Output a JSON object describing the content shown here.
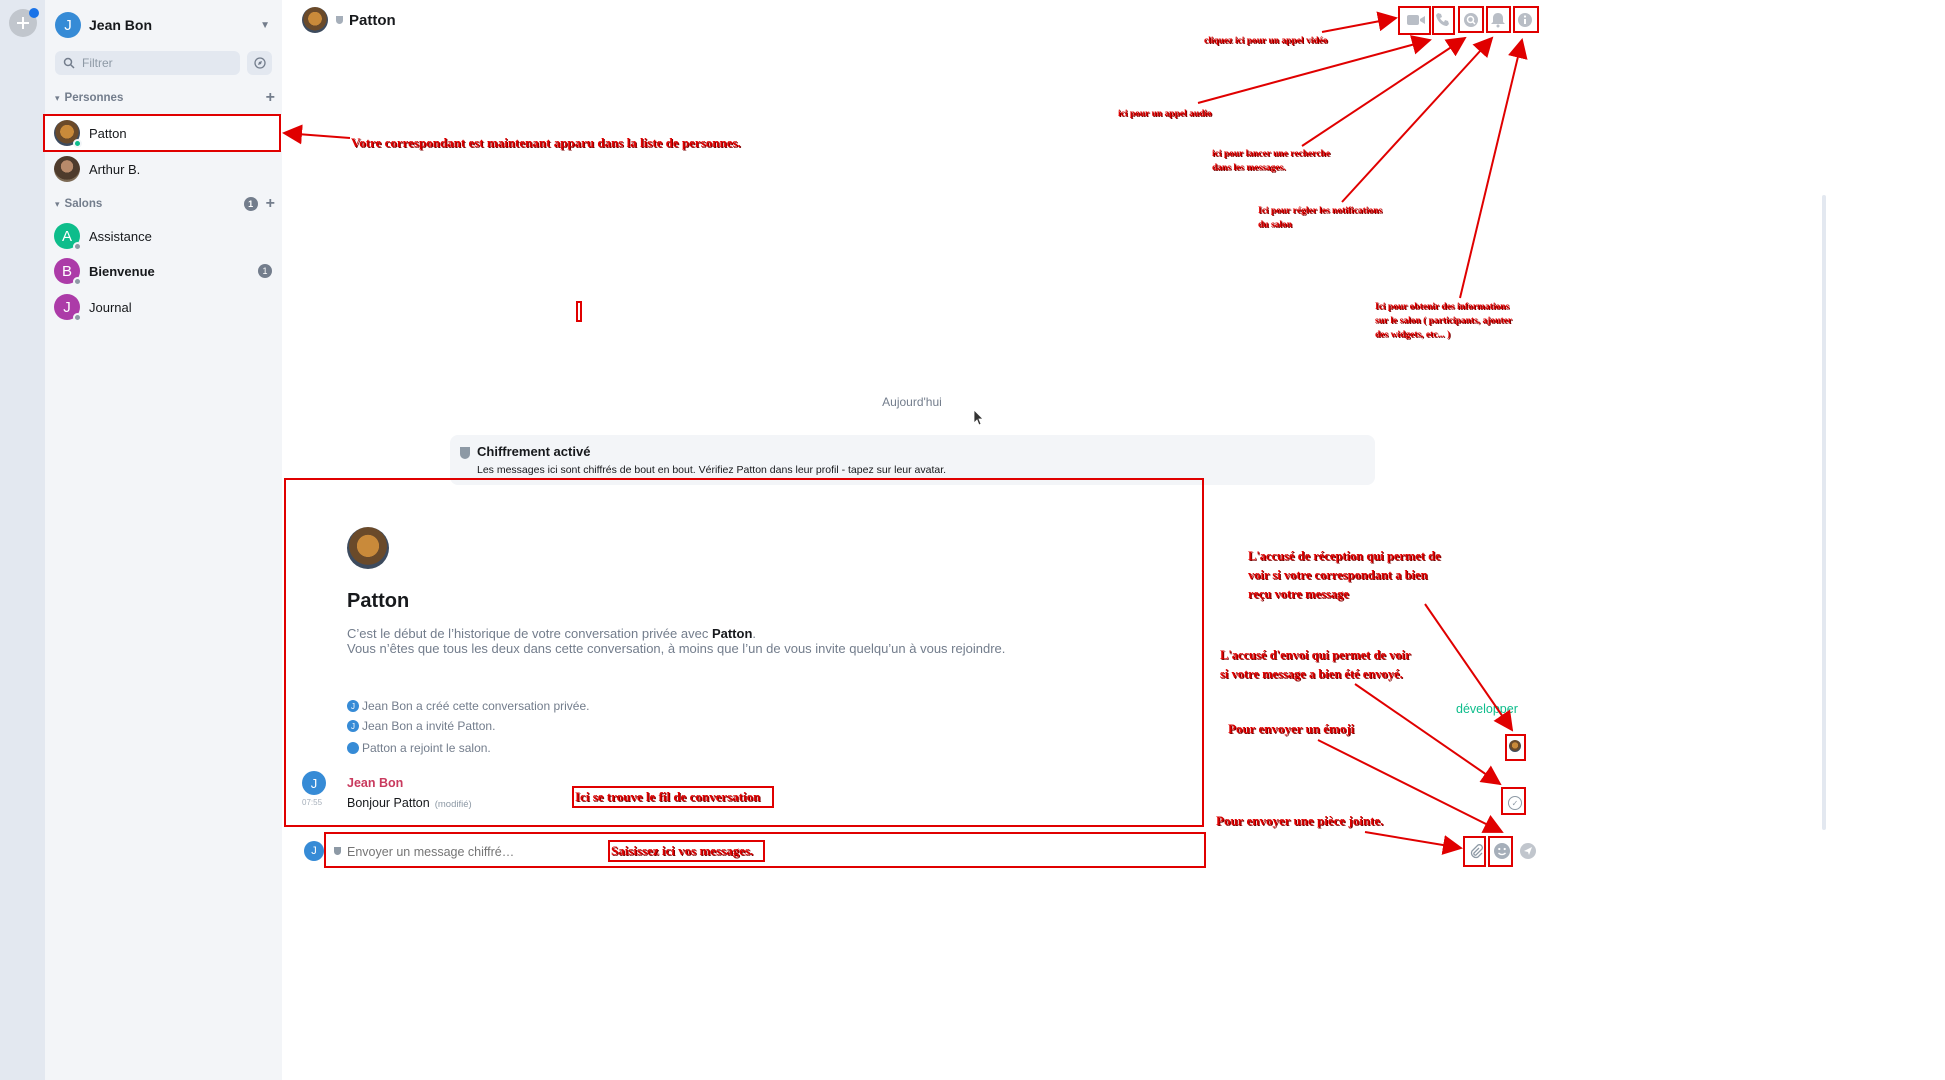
{
  "user": {
    "name": "Jean Bon",
    "initial": "J"
  },
  "sidebar": {
    "filter_placeholder": "Filtrer",
    "people": {
      "label": "Personnes",
      "items": [
        {
          "name": "Patton",
          "avatar": "lion-avatar"
        },
        {
          "name": "Arthur B.",
          "avatar": "man-avatar"
        }
      ]
    },
    "rooms": {
      "label": "Salons",
      "count": "1",
      "items": [
        {
          "name": "Assistance",
          "initial": "A",
          "color": "#0dbd8b"
        },
        {
          "name": "Bienvenue",
          "initial": "B",
          "color": "#ac3ba8",
          "badge": "1"
        },
        {
          "name": "Journal",
          "initial": "J",
          "color": "#ac3ba8"
        }
      ]
    }
  },
  "room": {
    "name": "Patton",
    "date_separator": "Aujourd'hui",
    "encryption": {
      "title": "Chiffrement activé",
      "description": "Les messages ici sont chiffrés de bout en bout. Vérifiez Patton dans leur profil - tapez sur leur avatar."
    },
    "intro": {
      "name": "Patton",
      "line1_pre": "C’est le début de l’historique de votre conversation privée avec ",
      "line1_name": "Patton",
      "line1_post": ".",
      "line2": "Vous n’êtes que tous les deux dans cette conversation, à moins que l’un de vous invite quelqu’un à vous rejoindre."
    },
    "events": [
      "Jean Bon a créé cette conversation privée.",
      "Jean Bon a invité Patton.",
      "Patton a rejoint le salon."
    ],
    "message": {
      "sender": "Jean Bon",
      "time": "07:55",
      "body": "Bonjour Patton",
      "edited": "(modifié)"
    },
    "expand": "développer",
    "composer_placeholder": "Envoyer un message chiffré…"
  },
  "annotations": {
    "video": "cliquez ici pour un appel vidéo",
    "audio": "ici pour un appel audio",
    "search_1": "ici pour lancer une recherche",
    "search_2": "dans les messages.",
    "notif_1": "Ici pour régler les notifications",
    "notif_2": "du salon",
    "info_1": "Ici pour obtenir des informations",
    "info_2": "sur le salon ( participants, ajouter",
    "info_3": "des widgets, etc... )",
    "people": "Votre correspondant est maintenant apparu dans la liste de personnes.",
    "read_1": "L'accusé de réception qui permet de",
    "read_2": "voir si votre correspondant a bien",
    "read_3": "reçu votre message",
    "sent_1": "L'accusé d'envoi qui permet de voir",
    "sent_2": "si votre message a bien été envoyé.",
    "emoji": "Pour envoyer un émoji",
    "attach": "Pour envoyer une pièce jointe.",
    "timeline": "Ici se trouve le fil de conversation",
    "composer": "Saisissez ici vos messages."
  },
  "colors": {
    "annotation": "#e00000",
    "accent": "#0dbd8b",
    "avatar_blue": "#368bd6"
  }
}
